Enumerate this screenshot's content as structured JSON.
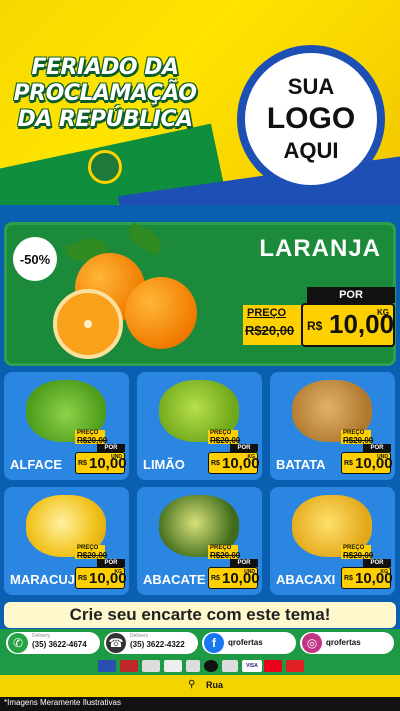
{
  "header": {
    "title_lines": [
      "FERIADO DA",
      "PROCLAMAÇÃO",
      "DA REPÚBLICA"
    ],
    "logo_lines": [
      "SUA",
      "LOGO",
      "AQUI"
    ]
  },
  "featured": {
    "discount": "-50%",
    "name": "LARANJA",
    "preco_label": "PREÇO",
    "old_price": "R$20,00",
    "por_label": "POR",
    "currency": "R$",
    "price": "10,00",
    "unit": "KG"
  },
  "products": [
    {
      "name": "ALFACE",
      "preco_label": "PREÇO",
      "old_price": "R$20,00",
      "por_label": "POR",
      "currency": "R$",
      "price": "10,00",
      "unit": "UND"
    },
    {
      "name": "LIMÃO",
      "preco_label": "PREÇO",
      "old_price": "R$20,00",
      "por_label": "POR",
      "currency": "R$",
      "price": "10,00",
      "unit": "KG"
    },
    {
      "name": "BATATA",
      "preco_label": "PREÇO",
      "old_price": "R$20,00",
      "por_label": "POR",
      "currency": "R$",
      "price": "10,00",
      "unit": "UND"
    },
    {
      "name": "MARACUJÁ",
      "preco_label": "PREÇO",
      "old_price": "R$20,00",
      "por_label": "POR",
      "currency": "R$",
      "price": "10,00",
      "unit": "KG"
    },
    {
      "name": "ABACATE",
      "preco_label": "PREÇO",
      "old_price": "R$20,00",
      "por_label": "POR",
      "currency": "R$",
      "price": "10,00",
      "unit": "UND"
    },
    {
      "name": "ABACAXI",
      "preco_label": "PREÇO",
      "old_price": "R$20,00",
      "por_label": "POR",
      "currency": "R$",
      "price": "10,00",
      "unit": "KG"
    }
  ],
  "banner": "Crie seu encarte com este tema!",
  "contacts": [
    {
      "label": "Delivery",
      "text": "(35) 3622-4674",
      "icon": "whatsapp-icon"
    },
    {
      "label": "Delivery",
      "text": "(35) 3622-4322",
      "icon": "phone-icon"
    },
    {
      "label": "",
      "text": "qrofertas",
      "icon": "facebook-icon"
    },
    {
      "label": "",
      "text": "qrofertas",
      "icon": "instagram-icon"
    }
  ],
  "payments": [
    "",
    "",
    "",
    "",
    "",
    "",
    "",
    "VISA",
    "",
    ""
  ],
  "address": "Rua",
  "disclaimer": "*Imagens Meramente Ilustrativas",
  "colors": {
    "green": "#1b8a3b",
    "blue": "#2a86e0",
    "yellow": "#ffd000"
  }
}
